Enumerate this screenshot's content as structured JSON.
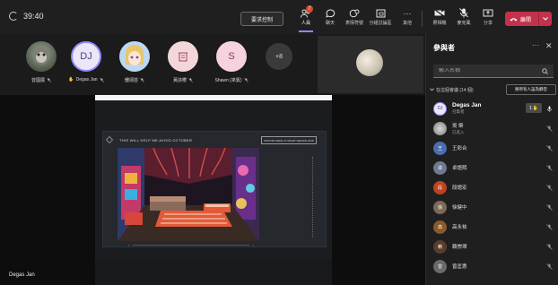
{
  "meeting": {
    "duration": "39:40",
    "request_control_label": "要求控制",
    "toolbar": [
      {
        "label": "人員",
        "icon": "people-icon",
        "badge": "7"
      },
      {
        "label": "聊天",
        "icon": "chat-icon"
      },
      {
        "label": "表情符號",
        "icon": "reactions-icon"
      },
      {
        "label": "分組討論區",
        "icon": "breakout-rooms-icon"
      },
      {
        "label": "其他",
        "icon": "more-icon"
      },
      {
        "label": "照相機",
        "icon": "camera-off-icon"
      },
      {
        "label": "麥克風",
        "icon": "mic-off-icon"
      },
      {
        "label": "分享",
        "icon": "share-icon"
      }
    ],
    "leave_label": "離開"
  },
  "strip": {
    "participants": [
      {
        "name": "曾國展",
        "initials": "",
        "avatar": "photo"
      },
      {
        "name": "Degas Jan",
        "initials": "DJ",
        "avatar": "initials",
        "hand": true
      },
      {
        "name": "鍾翊芸",
        "initials": "",
        "avatar": "anime"
      },
      {
        "name": "黃詩櫻",
        "initials": "",
        "avatar": "icon"
      },
      {
        "name": "Shawn (來賓)",
        "initials": "S",
        "avatar": "initials"
      }
    ],
    "overflow_count": "+8"
  },
  "stage": {
    "presenter_name": "Degas Jan",
    "slide_title": "THIS WILL HELP ME AVOID OCTOBER",
    "slide_button": "ROTATE MAKE 17 RIGHT DESIGN 2018"
  },
  "panel": {
    "title": "參與者",
    "more": "···",
    "close": "✕",
    "search_placeholder": "輸入名稱",
    "section_label": "在這個會議 (14 個)",
    "mute_all_label": "將所有人設為靜音",
    "participants": [
      {
        "name": "Degas Jan",
        "role": "召集者",
        "initials": "DJ",
        "color": "#3b3f8f",
        "hand_count": "1"
      },
      {
        "name": "吳 榮",
        "role": "已進入",
        "initials": "吳",
        "color": "#8a8a8a"
      },
      {
        "name": "王彩合",
        "role": "",
        "initials": "王",
        "color": "#4a6fb0"
      },
      {
        "name": "卓語熙",
        "role": "",
        "initials": "卓",
        "color": "#6d7b91"
      },
      {
        "name": "段語宏",
        "role": "",
        "initials": "段",
        "color": "#c0431f"
      },
      {
        "name": "徐健中",
        "role": "",
        "initials": "徐",
        "color": "#7b6a5a"
      },
      {
        "name": "高永祐",
        "role": "",
        "initials": "高",
        "color": "#8b5a2b"
      },
      {
        "name": "賴崇璋",
        "role": "",
        "initials": "賴",
        "color": "#5a3d2b"
      },
      {
        "name": "曾匡惠",
        "role": "",
        "initials": "曾",
        "color": "#6a6a6a"
      }
    ]
  }
}
